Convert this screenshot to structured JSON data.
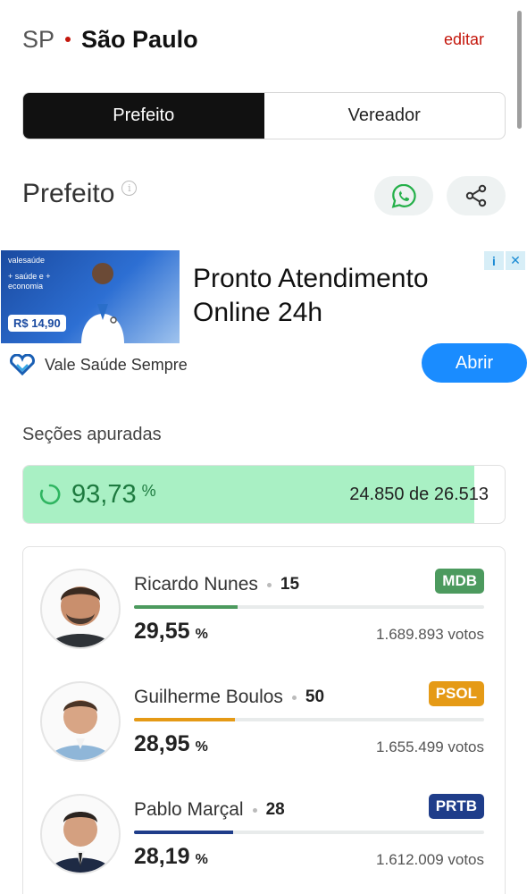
{
  "header": {
    "state": "SP",
    "city": "São Paulo",
    "edit_label": "editar"
  },
  "tabs": [
    {
      "label": "Prefeito",
      "active": true
    },
    {
      "label": "Vereador",
      "active": false
    }
  ],
  "section": {
    "title": "Prefeito"
  },
  "ad": {
    "headline": "Pronto Atendimento Online 24h",
    "advertiser": "Vale Saúde Sempre",
    "cta": "Abrir",
    "image_brand": "valesaúde",
    "image_tagline": "+ saúde e + economia",
    "image_price": "R$ 14,90"
  },
  "apuracao": {
    "label": "Seções apuradas",
    "percent": "93,73",
    "percent_sign": "%",
    "count": "24.850 de 26.513",
    "fraction": 0.9373
  },
  "candidates": [
    {
      "name": "Ricardo Nunes",
      "number": "15",
      "party": "MDB",
      "party_color": "#4c9a5e",
      "percent": "29,55",
      "votes": "1.689.893 votos",
      "share": 0.2955,
      "bar_color": "#4c9a5e"
    },
    {
      "name": "Guilherme Boulos",
      "number": "50",
      "party": "PSOL",
      "party_color": "#e59a16",
      "percent": "28,95",
      "votes": "1.655.499 votos",
      "share": 0.2895,
      "bar_color": "#e59a16"
    },
    {
      "name": "Pablo Marçal",
      "number": "28",
      "party": "PRTB",
      "party_color": "#1f3d8a",
      "percent": "28,19",
      "votes": "1.612.009 votos",
      "share": 0.2819,
      "bar_color": "#1f3d8a"
    }
  ],
  "percent_sign": "%"
}
